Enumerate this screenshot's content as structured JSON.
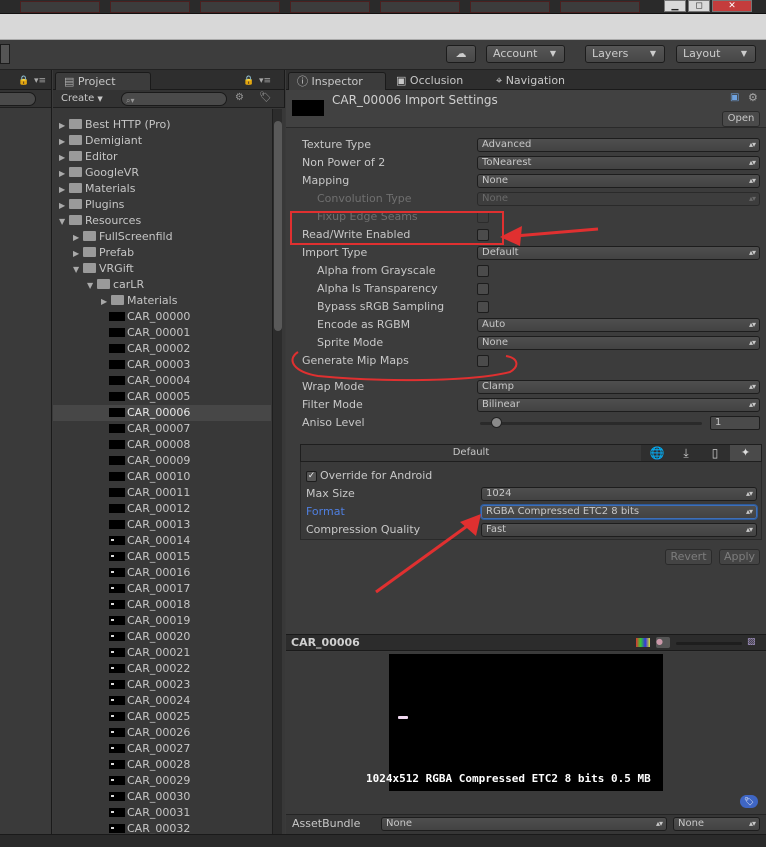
{
  "toolbar": {
    "account": "Account",
    "layers": "Layers",
    "layout": "Layout"
  },
  "project": {
    "tab": "Project",
    "create": "Create",
    "tree": [
      {
        "label": "Best HTTP (Pro)",
        "level": 0,
        "type": "folder",
        "expanded": false
      },
      {
        "label": "Demigiant",
        "level": 0,
        "type": "folder",
        "expanded": false
      },
      {
        "label": "Editor",
        "level": 0,
        "type": "folder",
        "expanded": false
      },
      {
        "label": "GoogleVR",
        "level": 0,
        "type": "folder",
        "expanded": false
      },
      {
        "label": "Materials",
        "level": 0,
        "type": "folder",
        "expanded": false
      },
      {
        "label": "Plugins",
        "level": 0,
        "type": "folder",
        "expanded": false
      },
      {
        "label": "Resources",
        "level": 0,
        "type": "folder",
        "expanded": true
      },
      {
        "label": "FullScreenfild",
        "level": 1,
        "type": "folder",
        "expanded": false
      },
      {
        "label": "Prefab",
        "level": 1,
        "type": "folder",
        "expanded": false
      },
      {
        "label": "VRGift",
        "level": 1,
        "type": "folder",
        "expanded": true
      },
      {
        "label": "carLR",
        "level": 2,
        "type": "folder",
        "expanded": true
      },
      {
        "label": "Materials",
        "level": 3,
        "type": "folder",
        "expanded": false
      }
    ],
    "assets": [
      "CAR_00000",
      "CAR_00001",
      "CAR_00002",
      "CAR_00003",
      "CAR_00004",
      "CAR_00005",
      "CAR_00006",
      "CAR_00007",
      "CAR_00008",
      "CAR_00009",
      "CAR_00010",
      "CAR_00011",
      "CAR_00012",
      "CAR_00013",
      "CAR_00014",
      "CAR_00015",
      "CAR_00016",
      "CAR_00017",
      "CAR_00018",
      "CAR_00019",
      "CAR_00020",
      "CAR_00021",
      "CAR_00022",
      "CAR_00023",
      "CAR_00024",
      "CAR_00025",
      "CAR_00026",
      "CAR_00027",
      "CAR_00028",
      "CAR_00029",
      "CAR_00030",
      "CAR_00031",
      "CAR_00032"
    ],
    "selected": "CAR_00006"
  },
  "tabs": {
    "inspector": "Inspector",
    "occlusion": "Occlusion",
    "navigation": "Navigation"
  },
  "inspector": {
    "title": "CAR_00006 Import Settings",
    "open": "Open",
    "texture_type_label": "Texture Type",
    "texture_type": "Advanced",
    "npot_label": "Non Power of 2",
    "npot": "ToNearest",
    "mapping_label": "Mapping",
    "mapping": "None",
    "convolution_label": "Convolution Type",
    "convolution": "None",
    "fixup_label": "Fixup Edge Seams",
    "readwrite_label": "Read/Write Enabled",
    "import_type_label": "Import Type",
    "import_type": "Default",
    "alpha_gray_label": "Alpha from Grayscale",
    "alpha_trans_label": "Alpha Is Transparency",
    "bypass_label": "Bypass sRGB Sampling",
    "encode_label": "Encode as RGBM",
    "encode": "Auto",
    "sprite_label": "Sprite Mode",
    "sprite": "None",
    "mip_label": "Generate Mip Maps",
    "wrap_label": "Wrap Mode",
    "wrap": "Clamp",
    "filter_label": "Filter Mode",
    "filter": "Bilinear",
    "aniso_label": "Aniso Level",
    "aniso": "1",
    "aniso_fraction": 0.07,
    "platform_default": "Default",
    "override_label": "Override for Android",
    "override_checked": true,
    "max_size_label": "Max Size",
    "max_size": "1024",
    "format_label": "Format",
    "format": "RGBA Compressed ETC2 8 bits",
    "quality_label": "Compression Quality",
    "quality": "Fast",
    "revert": "Revert",
    "apply": "Apply"
  },
  "preview": {
    "title": "CAR_00006",
    "info": "1024x512  RGBA Compressed ETC2 8 bits   0.5 MB"
  },
  "assetbundle": {
    "label": "AssetBundle",
    "name": "None",
    "variant": "None"
  },
  "colors": {
    "annotation_red": "#e03030",
    "link_blue": "#4f7fe0",
    "panel": "#3c3c3c"
  }
}
